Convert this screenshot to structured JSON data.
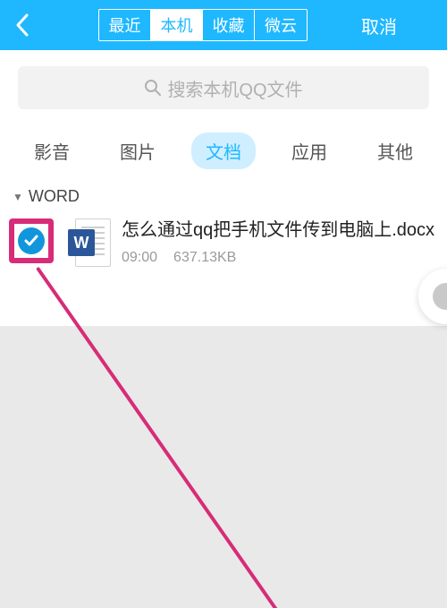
{
  "header": {
    "tabs": [
      "最近",
      "本机",
      "收藏",
      "微云"
    ],
    "active_tab_index": 1,
    "cancel_label": "取消"
  },
  "search": {
    "placeholder": "搜索本机QQ文件"
  },
  "categories": {
    "items": [
      "影音",
      "图片",
      "文档",
      "应用",
      "其他"
    ],
    "active_index": 2
  },
  "section": {
    "title": "WORD"
  },
  "files": [
    {
      "name": "怎么通过qq把手机文件传到电脑上.docx",
      "time": "09:00",
      "size": "637.13KB",
      "selected": true,
      "icon": "word"
    }
  ],
  "icons": {
    "word_badge": "W"
  }
}
